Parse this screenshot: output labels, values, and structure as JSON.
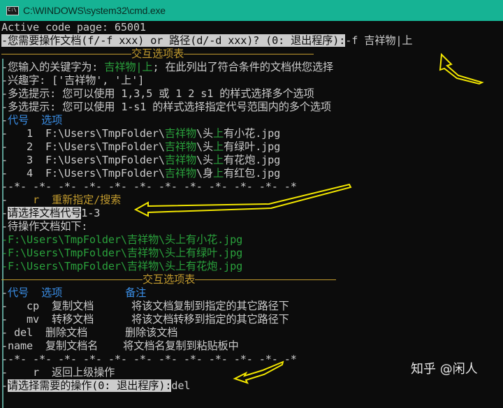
{
  "window": {
    "title": "C:\\WINDOWS\\system32\\cmd.exe",
    "icon": "console-icon"
  },
  "console": {
    "code_page_line": "Active code page: 65001",
    "prompt1": {
      "label": "您需要操作文档(f/-f xxx) or 路径(d/-d xxx)? (0: 退出程序):",
      "input": "-f 吉祥物|上"
    },
    "menu_title": "交互选项表",
    "keyword_line": {
      "prefix": "您输入的关键字为: ",
      "keyword": "吉祥物|上",
      "suffix": "; 在此列出了符合条件的文档供您选择"
    },
    "interest_line": "兴趣字: ['吉祥物', '上']",
    "hint1": "多选提示: 您可以使用 1,3,5 或 1 2 s1 的样式选择多个选项",
    "hint2": "多选提示: 您可以使用 1-s1 的样式选择指定代号范围内的多个选项",
    "list_header": {
      "code": "代号",
      "option": "选项"
    },
    "files": [
      {
        "code": "1",
        "prefix": "F:\\Users\\TmpFolder\\",
        "kw1": "吉祥物",
        "mid": "\\头",
        "kw2": "上",
        "rest": "有小花.jpg"
      },
      {
        "code": "2",
        "prefix": "F:\\Users\\TmpFolder\\",
        "kw1": "吉祥物",
        "mid": "\\头",
        "kw2": "上",
        "rest": "有绿叶.jpg"
      },
      {
        "code": "3",
        "prefix": "F:\\Users\\TmpFolder\\",
        "kw1": "吉祥物",
        "mid": "\\头",
        "kw2": "上",
        "rest": "有花炮.jpg"
      },
      {
        "code": "4",
        "prefix": "F:\\Users\\TmpFolder\\",
        "kw1": "吉祥物",
        "mid": "\\身",
        "kw2": "上",
        "rest": "有红包.jpg"
      }
    ],
    "star_separator": "--*- -*- -*- -*- -*- -*- -*- -*- -*- -*- -*- -*",
    "reselect": {
      "code": "r",
      "label": "重新指定/搜索"
    },
    "prompt2": {
      "label": "请选择文档代号",
      "input": "1-3"
    },
    "pending_title": "待操作文档如下:",
    "pending_files": [
      "F:\\Users\\TmpFolder\\吉祥物\\头上有小花.jpg",
      "F:\\Users\\TmpFolder\\吉祥物\\头上有绿叶.jpg",
      "F:\\Users\\TmpFolder\\吉祥物\\头上有花炮.jpg"
    ],
    "menu_title2": "交互选项表",
    "ops_header": {
      "code": "代号",
      "option": "选项",
      "note": "备注"
    },
    "ops": [
      {
        "code": "cp",
        "option": "复制文档",
        "note": "将该文档复制到指定的其它路径下"
      },
      {
        "code": "mv",
        "option": "转移文档",
        "note": "将该文档转移到指定的其它路径下"
      },
      {
        "code": "del",
        "option": "删除文档",
        "note": "删除该文档"
      },
      {
        "code": "name",
        "option": "复制文档名",
        "note": "将文档名复制到粘贴板中"
      }
    ],
    "star_separator2": "--*- -*- -*- -*- -*- -*- -*- -*- -*- -*- -*- -*",
    "back": {
      "code": "r",
      "label": "返回上级操作"
    },
    "prompt3": {
      "label": "请选择需要的操作(0: 退出程序):",
      "input": "del"
    }
  },
  "watermark": "知乎 @闲人",
  "colors": {
    "titlebar": "#16b394",
    "background": "#0c0c0c",
    "text": "#cccccc",
    "green": "#2aa13c",
    "blue": "#3a8ee6",
    "gold": "#c19a2e",
    "arrow": "#f2e600"
  }
}
